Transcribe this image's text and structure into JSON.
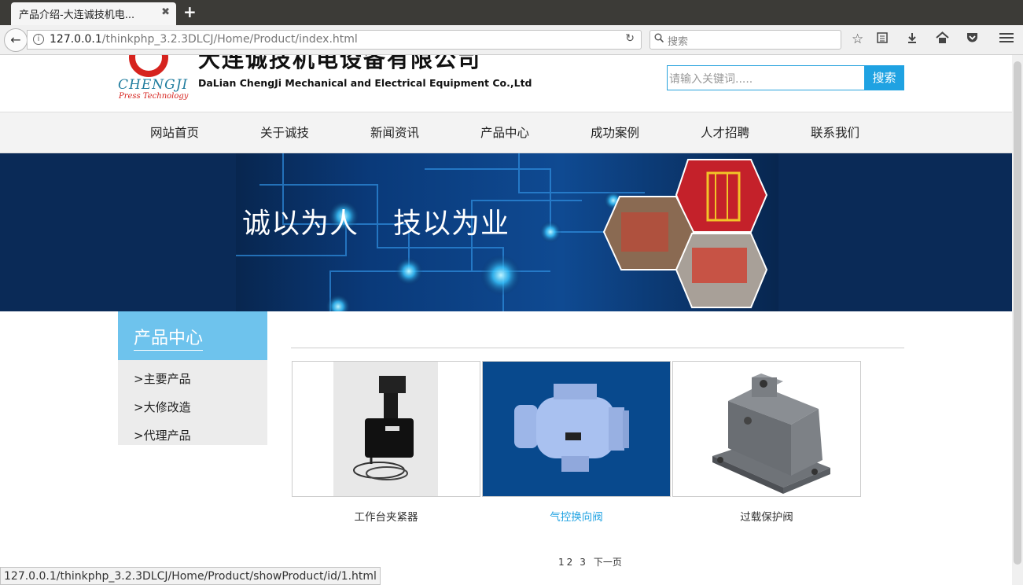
{
  "browser": {
    "tab_title": "产品介绍-大连诚技机电...",
    "tab_close": "✖",
    "new_tab": "+",
    "back": "←",
    "url_host": "127.0.0.1",
    "url_path": "/thinkphp_3.2.3DLCJ/Home/Product/index.html",
    "reload": "↻",
    "search_placeholder": "搜索",
    "status_url": "127.0.0.1/thinkphp_3.2.3DLCJ/Home/Product/showProduct/id/1.html"
  },
  "header": {
    "company_cn": "大连诚技机电设备有限公司",
    "company_en": "DaLian ChengJi Mechanical and Electrical Equipment Co.,Ltd",
    "logo_text": "CHENGJI",
    "logo_sub": "Press Technology",
    "search_placeholder": "请输入关键词.....",
    "search_button": "搜索"
  },
  "nav": {
    "items": [
      "网站首页",
      "关于诚技",
      "新闻资讯",
      "产品中心",
      "成功案例",
      "人才招聘",
      "联系我们"
    ]
  },
  "banner": {
    "slogan1": "诚以为人",
    "slogan2": "技以为业"
  },
  "sidebar": {
    "title": "产品中心",
    "items": [
      ">主要产品",
      ">大修改造",
      ">代理产品"
    ]
  },
  "products": [
    {
      "name": "工作台夹紧器",
      "highlight": false
    },
    {
      "name": "气控换向阀",
      "highlight": true
    },
    {
      "name": "过载保护阀",
      "highlight": false
    }
  ],
  "pager": {
    "pages": [
      "1",
      "2",
      "3"
    ],
    "next": "下一页"
  },
  "colors": {
    "accent": "#1fa2e2",
    "sidebar_head": "#6ec3ed",
    "banner_bg": "#0a2a57",
    "highlight_text": "#1fa2e2"
  }
}
